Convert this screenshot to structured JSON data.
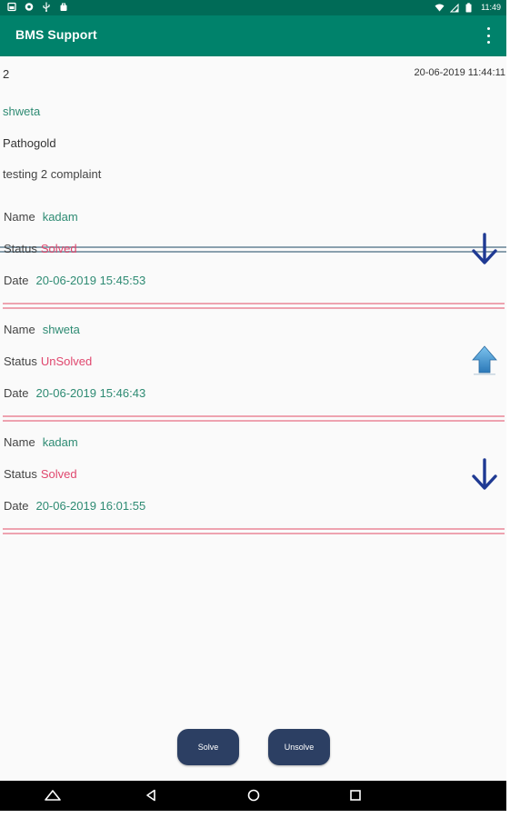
{
  "status_bar": {
    "time": "11:49",
    "left_icons": [
      "gallery-icon",
      "sync-icon",
      "usb-icon",
      "bag-icon"
    ],
    "right_icons": [
      "wifi-icon",
      "signal-icon",
      "battery-icon"
    ]
  },
  "app_bar": {
    "title": "BMS Support",
    "menu_icon": "overflow-menu-icon"
  },
  "complaint": {
    "id": "2",
    "datetime": "20-06-2019 11:44:11",
    "user": "shweta",
    "company": "Pathogold",
    "description": "testing 2 complaint"
  },
  "replies": [
    {
      "name_label": "Name",
      "name": "kadam",
      "status_label": "Status",
      "status": "Solved",
      "date_label": "Date",
      "date": "20-06-2019 15:45:53",
      "icon": "arrow-down-icon"
    },
    {
      "name_label": "Name",
      "name": "shweta",
      "status_label": "Status",
      "status": "UnSolved",
      "date_label": "Date",
      "date": "20-06-2019 15:46:43",
      "icon": "arrow-up-icon"
    },
    {
      "name_label": "Name",
      "name": "kadam",
      "status_label": "Status",
      "status": "Solved",
      "date_label": "Date",
      "date": "20-06-2019 16:01:55",
      "icon": "arrow-down-icon"
    }
  ],
  "actions": {
    "solve_label": "Solve",
    "unsolve_label": "Unsolve"
  },
  "nav_bar": {
    "icons": [
      "home-icon",
      "back-icon",
      "home-circle-icon",
      "recents-icon"
    ]
  },
  "colors": {
    "status_bar": "#006b57",
    "app_bar": "#00826b",
    "accent_green": "#2e8b73",
    "status_red": "#e0476e",
    "button_bg": "#2c3f63",
    "arrow_down": "#1f3a93",
    "arrow_up": "#3a8fcf"
  }
}
